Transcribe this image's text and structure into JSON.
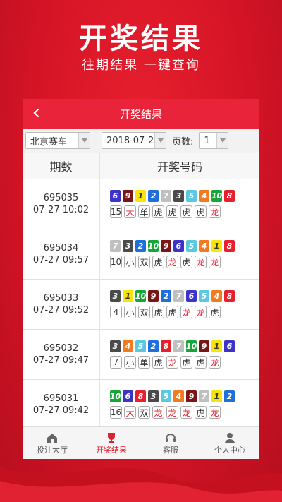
{
  "promo": {
    "title": "开奖结果",
    "subtitle": "往期结果  一键查询"
  },
  "navbar": {
    "title": "开奖结果",
    "back_icon": "chevron-left-icon"
  },
  "filters": {
    "lottery": "北京赛车",
    "date": "2018-07-2",
    "page_label": "页数:",
    "page": "1"
  },
  "table": {
    "headers": [
      "期数",
      "开奖号码"
    ],
    "rows": [
      {
        "issue": "695035",
        "time": "07-27 10:02",
        "numbers": [
          "6",
          "9",
          "1",
          "2",
          "7",
          "3",
          "5",
          "4",
          "10",
          "8"
        ],
        "attrs": [
          "15",
          "大",
          "单",
          "虎",
          "虎",
          "虎",
          "虎",
          "龙"
        ]
      },
      {
        "issue": "695034",
        "time": "07-27 09:57",
        "numbers": [
          "7",
          "3",
          "2",
          "10",
          "9",
          "6",
          "5",
          "4",
          "1",
          "8"
        ],
        "attrs": [
          "10",
          "小",
          "双",
          "虎",
          "龙",
          "虎",
          "龙",
          "龙"
        ]
      },
      {
        "issue": "695033",
        "time": "07-27 09:52",
        "numbers": [
          "3",
          "1",
          "10",
          "9",
          "2",
          "7",
          "6",
          "5",
          "4",
          "8"
        ],
        "attrs": [
          "4",
          "小",
          "双",
          "虎",
          "虎",
          "龙",
          "龙",
          "虎"
        ]
      },
      {
        "issue": "695032",
        "time": "07-27 09:47",
        "numbers": [
          "3",
          "4",
          "5",
          "2",
          "8",
          "7",
          "10",
          "9",
          "1",
          "6"
        ],
        "attrs": [
          "7",
          "小",
          "单",
          "虎",
          "龙",
          "虎",
          "虎",
          "龙"
        ]
      },
      {
        "issue": "695031",
        "time": "07-27 09:42",
        "numbers": [
          "10",
          "6",
          "8",
          "3",
          "5",
          "4",
          "9",
          "7",
          "1",
          "2"
        ],
        "attrs": [
          "16",
          "大",
          "双",
          "龙",
          "龙",
          "龙",
          "虎",
          "龙"
        ]
      }
    ]
  },
  "ball_colors": {
    "1": "#f5e50a",
    "2": "#1e6fd9",
    "3": "#4a4a4a",
    "4": "#f47a1f",
    "5": "#5bc8e0",
    "6": "#3d33c9",
    "7": "#bfbfbf",
    "8": "#e8202e",
    "9": "#7a1518",
    "10": "#17a53a"
  },
  "tabbar": {
    "items": [
      {
        "label": "投注大厅",
        "icon": "home-icon"
      },
      {
        "label": "开奖结果",
        "icon": "trophy-icon"
      },
      {
        "label": "客服",
        "icon": "headset-icon"
      },
      {
        "label": "个人中心",
        "icon": "person-icon"
      }
    ]
  }
}
